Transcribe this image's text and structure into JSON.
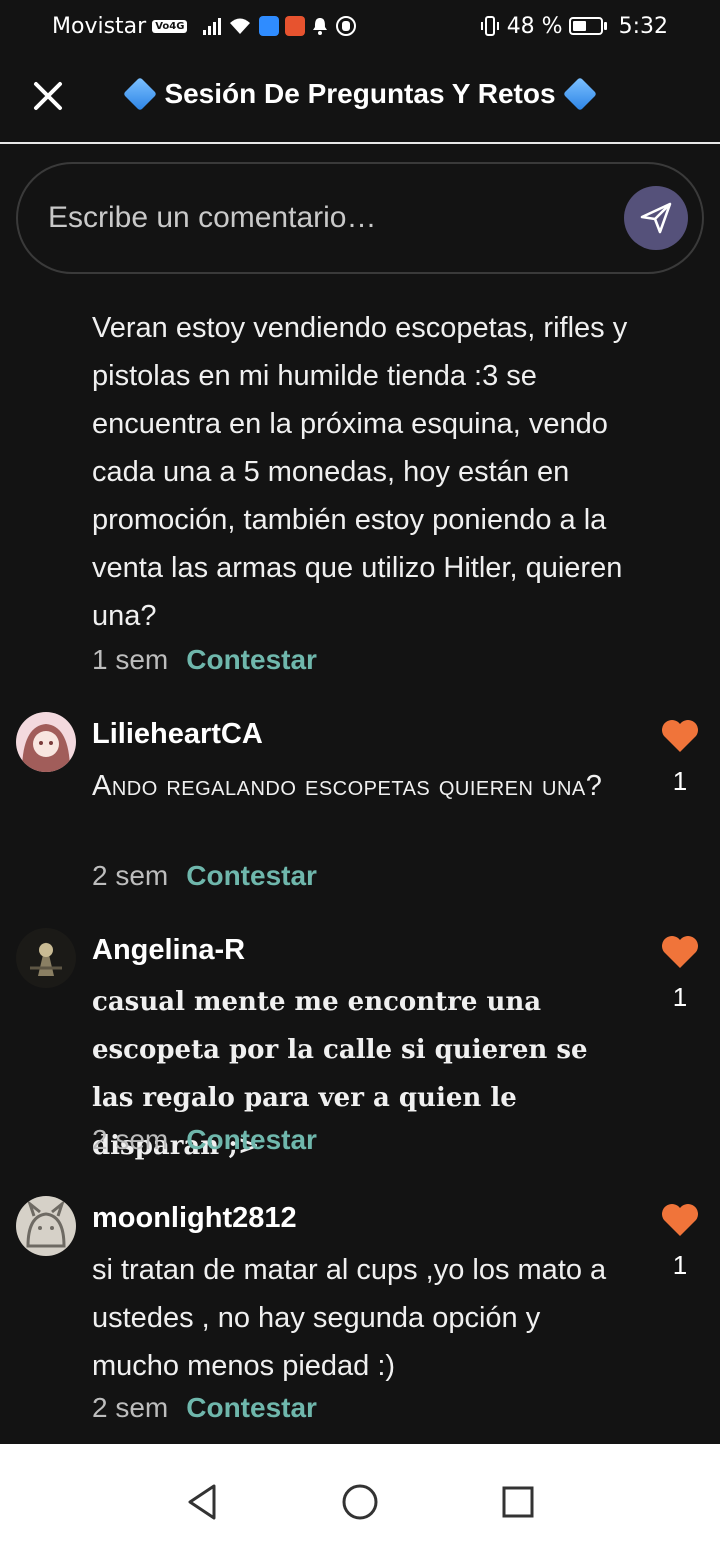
{
  "status_bar": {
    "carrier": "Movistar",
    "volte": "Vo4G",
    "battery": "48 %",
    "time": "5:32"
  },
  "header": {
    "title": "Sesión De Preguntas Y Retos"
  },
  "comment_input": {
    "placeholder": "Escribe un comentario…"
  },
  "reply_label": "Contestar",
  "first_comment": {
    "text": "Veran estoy vendiendo escopetas, rifles y pistolas en mi humilde tienda :3 se encuentra en la próxima esquina, vendo cada una a 5 monedas, hoy están en promoción, también estoy poniendo a la venta las armas que utilizo Hitler, quieren una?",
    "time": "1 sem"
  },
  "comments": [
    {
      "username": "LilieheartCA",
      "text": "Ando regalando escopetas quieren una?",
      "time": "2 sem",
      "likes": "1"
    },
    {
      "username": "Angelina-R",
      "text": "casual mente me encontre una escopeta por la calle si quieren se las regalo para ver a quien le disparan ;>",
      "time": "2 sem",
      "likes": "1"
    },
    {
      "username": "moonlight2812",
      "text": "si tratan de matar al cups ,yo los mato a ustedes , no hay segunda opción y mucho menos piedad :)",
      "time": "2 sem",
      "likes": "1"
    }
  ],
  "colors": {
    "background": "#131313",
    "heart": "#f0743a",
    "reply_link": "#6fb7ac",
    "send_button": "#55517a"
  }
}
